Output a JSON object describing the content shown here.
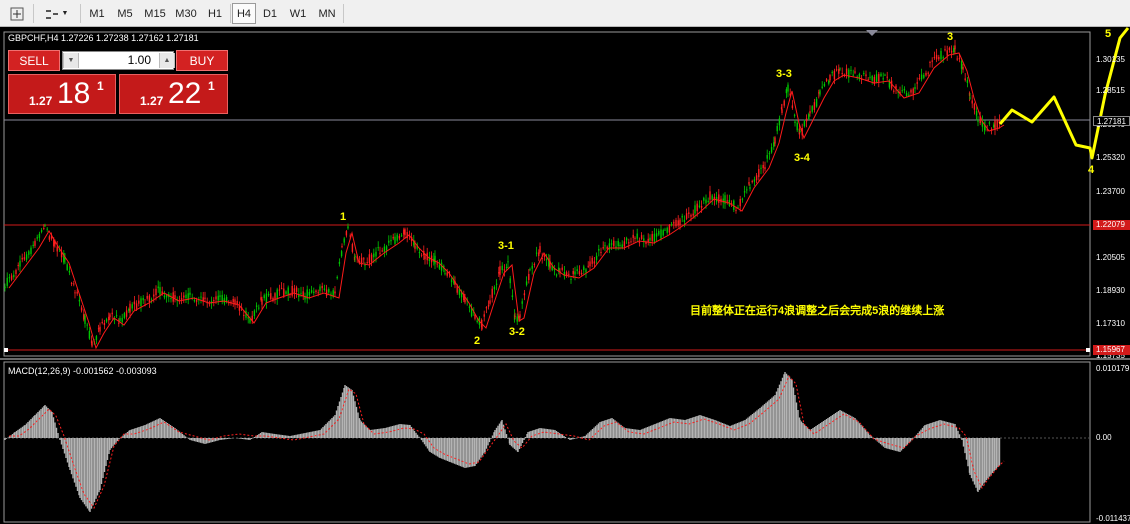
{
  "toolbar": {
    "icons": [
      "crosshair-icon",
      "objects-icon"
    ],
    "timeframes": [
      {
        "label": "M1",
        "active": false
      },
      {
        "label": "M5",
        "active": false
      },
      {
        "label": "M15",
        "active": false
      },
      {
        "label": "M30",
        "active": false
      },
      {
        "label": "H1",
        "active": false
      },
      {
        "label": "H4",
        "active": true
      },
      {
        "label": "D1",
        "active": false
      },
      {
        "label": "W1",
        "active": false
      },
      {
        "label": "MN",
        "active": false
      }
    ]
  },
  "chart": {
    "symbol_line": "GBPCHF,H4  1.27226 1.27238 1.27162 1.27181",
    "price_axis": [
      "1.30135",
      "1.28515",
      "1.26940",
      "1.25320",
      "1.23700",
      "1.22079",
      "1.20505",
      "1.18930",
      "1.17310",
      "1.15735"
    ],
    "current_price_tag": "1.27181",
    "upper_line_tag": "1.22079",
    "lower_line_tag": "1.15967",
    "wave_labels": {
      "w1": "1",
      "w2": "2",
      "w3_1": "3-1",
      "w3_2": "3-2",
      "w3_3": "3-3",
      "w3_4": "3-4",
      "w3": "3",
      "w4": "4",
      "w5": "5"
    },
    "annotation": "目前整体正在运行4浪调整之后会完成5浪的继续上涨",
    "colors": {
      "bull": "#00c800",
      "bear": "#ff2020",
      "ma": "#ff1a1a",
      "projection": "#ffff00"
    }
  },
  "trade_panel": {
    "sell_label": "SELL",
    "buy_label": "BUY",
    "lot_value": "1.00",
    "bid": {
      "small": "1.27",
      "big": "18",
      "sup": "1"
    },
    "ask": {
      "small": "1.27",
      "big": "22",
      "sup": "1"
    }
  },
  "macd": {
    "label": "MACD(12,26,9) -0.001562 -0.003093",
    "axis": [
      "0.010179",
      "0.00",
      "-0.011437"
    ]
  }
}
